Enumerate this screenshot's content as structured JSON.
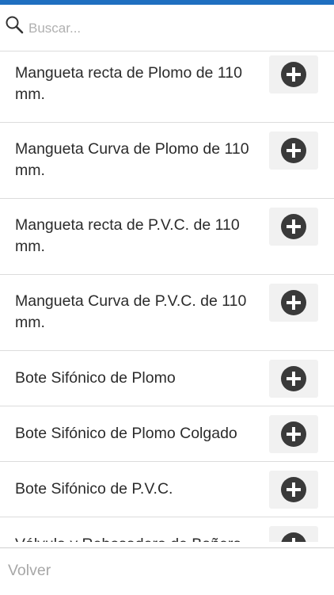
{
  "search": {
    "placeholder": "Buscar...",
    "value": ""
  },
  "items": [
    {
      "label": "Mangueta recta de Plomo de 110 mm."
    },
    {
      "label": "Mangueta Curva de Plomo de 110 mm."
    },
    {
      "label": "Mangueta recta de P.V.C. de 110 mm."
    },
    {
      "label": "Mangueta Curva de P.V.C. de 110 mm."
    },
    {
      "label": "Bote Sifónico de Plomo"
    },
    {
      "label": "Bote Sifónico de Plomo Colgado"
    },
    {
      "label": "Bote Sifónico de P.V.C."
    },
    {
      "label": "Válvula y Rebosadero de Bañera"
    }
  ],
  "footer": {
    "back_label": "Volver"
  },
  "colors": {
    "accent": "#1f6fc0",
    "add_button": "#3a3a3a",
    "divider": "#dcdcdc"
  },
  "icons": {
    "search": "search-icon",
    "add": "plus-circle-icon"
  }
}
